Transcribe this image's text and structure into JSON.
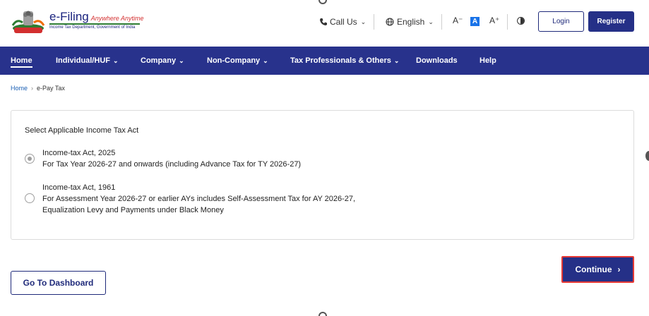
{
  "header": {
    "brand_title": "e-Filing",
    "brand_tagline": "Anywhere Anytime",
    "brand_subtitle": "Income Tax Department, Government of India",
    "call_us": "Call Us",
    "language": "English",
    "font_decrease": "A⁻",
    "font_normal": "A",
    "font_increase": "A⁺",
    "login_label": "Login",
    "register_label": "Register"
  },
  "nav": {
    "items": [
      {
        "label": "Home"
      },
      {
        "label": "Individual/HUF"
      },
      {
        "label": "Company"
      },
      {
        "label": "Non-Company"
      },
      {
        "label": "Tax Professionals & Others"
      },
      {
        "label": "Downloads"
      },
      {
        "label": "Help"
      }
    ]
  },
  "breadcrumb": {
    "home": "Home",
    "current": "e-Pay Tax"
  },
  "form": {
    "title": "Select Applicable Income Tax Act",
    "options": [
      {
        "label": "Income-tax Act, 2025",
        "desc1": "For Tax Year 2026-27 and onwards (including Advance Tax for TY 2026-27)",
        "desc2": "",
        "checked": true
      },
      {
        "label": "Income-tax Act, 1961",
        "desc1": "For Assessment Year 2026-27 or earlier AYs includes Self-Assessment Tax for AY 2026-27,",
        "desc2": "Equalization Levy and Payments under Black Money",
        "checked": false
      }
    ]
  },
  "actions": {
    "dashboard_label": "Go To Dashboard",
    "continue_label": "Continue"
  },
  "colors": {
    "nav_bg": "#28328c",
    "primary": "#253087",
    "highlight": "#e53935"
  },
  "icons": {
    "phone": "phone-icon",
    "globe": "globe-icon",
    "contrast": "contrast-icon",
    "chevron": "chevron-down-icon"
  }
}
